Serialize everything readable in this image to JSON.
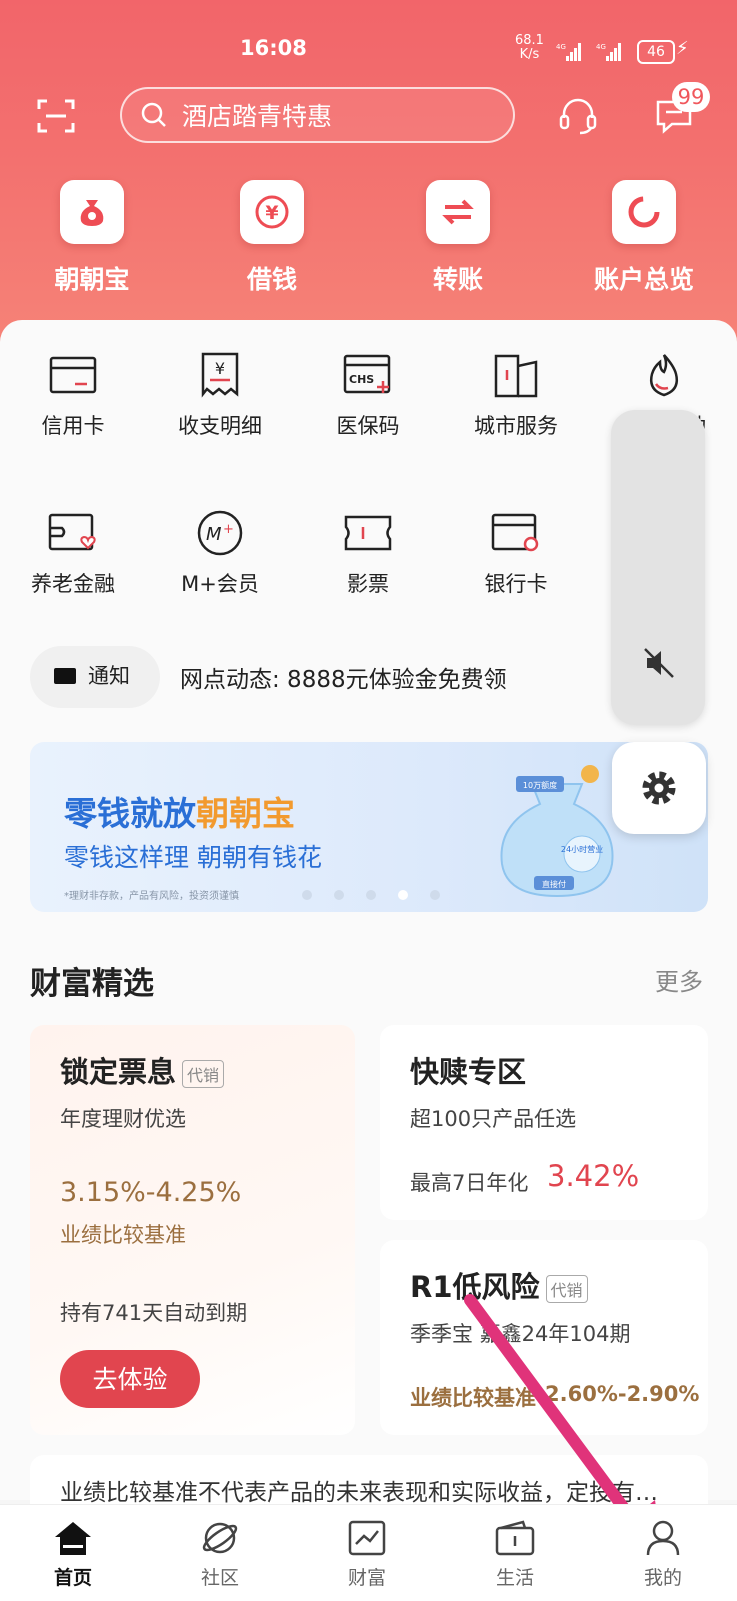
{
  "status_bar": {
    "time": "16:08",
    "net_speed": "68.1",
    "net_unit": "K/s",
    "signal1": "4G",
    "signal2": "4G",
    "battery": "46"
  },
  "header": {
    "search_placeholder": "酒店踏青特惠",
    "message_badge": "99"
  },
  "quick_actions": [
    {
      "label": "朝朝宝",
      "icon": "money-bag-icon"
    },
    {
      "label": "借钱",
      "icon": "yen-coin-icon"
    },
    {
      "label": "转账",
      "icon": "transfer-arrows-icon"
    },
    {
      "label": "账户总览",
      "icon": "ring-chart-icon"
    }
  ],
  "services_row1": [
    {
      "label": "信用卡"
    },
    {
      "label": "收支明细"
    },
    {
      "label": "医保码"
    },
    {
      "label": "城市服务"
    },
    {
      "label": "热门活动"
    }
  ],
  "services_row2": [
    {
      "label": "养老金融"
    },
    {
      "label": "M+会员"
    },
    {
      "label": "影票"
    },
    {
      "label": "银行卡"
    }
  ],
  "notice": {
    "pill_label": "通知",
    "text": "网点动态: 8888元体验金免费领"
  },
  "banner": {
    "title_part1": "零钱就放",
    "title_part2": "朝朝宝",
    "subtitle": "零钱这样理 朝朝有钱花",
    "disclaimer": "*理财非存款，产品有风险，投资须谨慎",
    "bag_tag": "10万额度",
    "bag_24h": "24小时营业",
    "bag_pay": "直接付",
    "active_dot": 3
  },
  "wealth": {
    "title": "财富精选",
    "more": "更多",
    "card1": {
      "title": "锁定票息",
      "tag": "代销",
      "subtitle": "年度理财优选",
      "rate": "3.15%-4.25%",
      "rate_label": "业绩比较基准",
      "hold": "持有741天自动到期",
      "button": "去体验"
    },
    "card2": {
      "title": "快赎专区",
      "subtitle": "超100只产品任选",
      "rate_label": "最高7日年化",
      "rate": "3.42%"
    },
    "card3": {
      "title": "R1低风险",
      "tag": "代销",
      "subtitle": "季季宝 嘉鑫24年104期",
      "rate_label": "业绩比较基准",
      "rate": "2.60%-2.90%"
    }
  },
  "disclosure": "业绩比较基准不代表产品的未来表现和实际收益，定投有…",
  "tabs": [
    {
      "label": "首页",
      "active": true
    },
    {
      "label": "社区"
    },
    {
      "label": "财富"
    },
    {
      "label": "生活"
    },
    {
      "label": "我的"
    }
  ],
  "colors": {
    "brand_red": "#f0575c",
    "blue": "#2a6fd6",
    "orange": "#f29a2e",
    "arrow": "#e0337a"
  }
}
